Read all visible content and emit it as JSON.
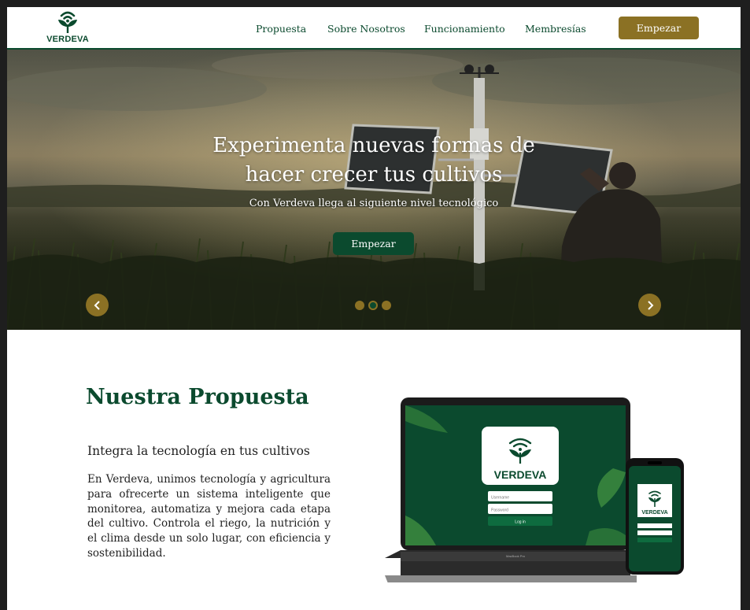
{
  "header": {
    "logo_text": "VERDEVA",
    "nav": [
      {
        "label": "Propuesta"
      },
      {
        "label": "Sobre Nosotros"
      },
      {
        "label": "Funcionamiento"
      },
      {
        "label": "Membresías"
      }
    ],
    "cta_label": "Empezar"
  },
  "hero": {
    "title_line1": "Experimenta nuevas formas de",
    "title_line2": "hacer crecer tus cultivos",
    "subtitle": "Con Verdeva llega al siguiente nivel tecnológico",
    "cta_label": "Empezar",
    "slides_count": 3,
    "active_slide": 2
  },
  "proposal": {
    "title": "Nuestra Propuesta",
    "subtitle": "Integra la tecnología en tus cultivos",
    "body": "En Verdeva, unimos tecnología y agricultura para ofrecerte un sistema inteligente que monitorea, automatiza y mejora cada etapa del cultivo. Controla el riego, la nutrición y el clima desde un solo lugar, con eficiencia y sostenibilidad.",
    "mockup": {
      "laptop_logo": "VERDEVA",
      "username_placeholder": "Username",
      "password_placeholder": "Password",
      "login_label": "Log in",
      "laptop_model": "MacBook Pro",
      "phone_logo": "VERDEVA"
    }
  },
  "colors": {
    "brand_green": "#0b4a2e",
    "brand_gold": "#8b7124"
  }
}
